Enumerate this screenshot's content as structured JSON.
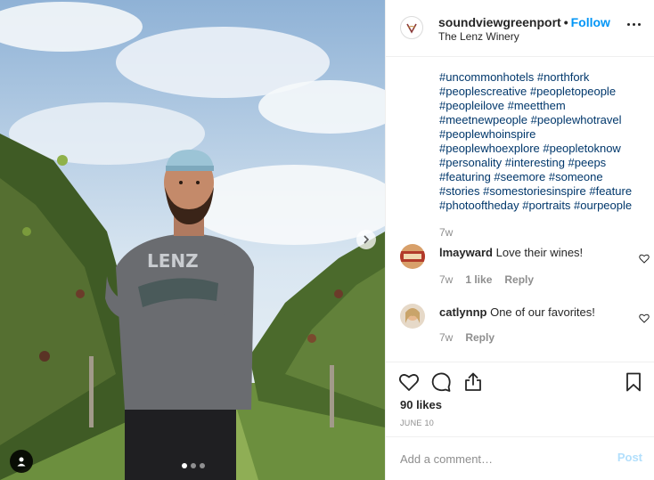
{
  "post": {
    "image_alt_icon": "photo",
    "carousel_dots": 3,
    "carousel_active_index": 0
  },
  "header": {
    "username": "soundviewgreenport",
    "separator": "•",
    "follow_label": "Follow",
    "location": "The Lenz Winery",
    "more_icon": "more-horizontal-icon"
  },
  "caption": {
    "lines": [
      "#uncommonhotels #northfork",
      "#peoplescreative #peopletopeople",
      "#peopleilove #meetthem",
      "#meetnewpeople #peoplewhotravel",
      "#peoplewhoinspire",
      "#peoplewhoexplore #peopletoknow",
      "#personality #interesting #peeps",
      "#featuring #seemore #someone",
      "#stories #somestoriesinspire #feature",
      "#photooftheday #portraits #ourpeople"
    ],
    "time": "7w"
  },
  "comments": [
    {
      "username": "lmayward",
      "text": "Love their wines!",
      "time": "7w",
      "likes": "1 like",
      "reply": "Reply"
    },
    {
      "username": "catlynnp",
      "text": "One of our favorites!",
      "time": "7w",
      "reply": "Reply"
    }
  ],
  "actions": {
    "likes": "90 likes",
    "date": "JUNE 10"
  },
  "add_comment": {
    "placeholder": "Add a comment…",
    "post_label": "Post"
  },
  "colors": {
    "link": "#00376b",
    "follow": "#0095f6",
    "muted": "#8e8e8e",
    "post_disabled": "#b2dffc"
  }
}
